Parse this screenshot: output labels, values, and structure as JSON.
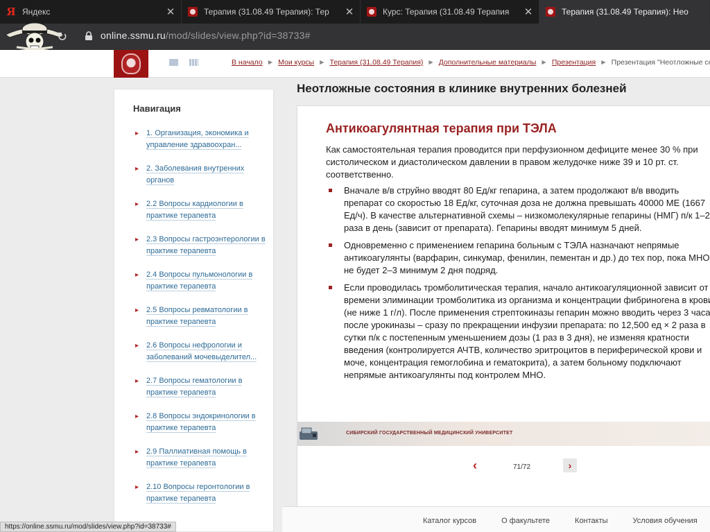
{
  "browser": {
    "tabs": [
      {
        "title": "Яндекс",
        "icon": "yandex-icon",
        "close": "✕"
      },
      {
        "title": "Терапия (31.08.49 Терапия): Тер",
        "icon": "university-crest-icon",
        "close": "✕"
      },
      {
        "title": "Курс: Терапия (31.08.49 Терапия",
        "icon": "university-crest-icon",
        "close": "✕"
      },
      {
        "title": "Терапия (31.08.49 Терапия): Нео",
        "icon": "university-crest-icon",
        "close": ""
      }
    ],
    "url_host": "online.ssmu.ru",
    "url_path": "/mod/slides/view.php?id=38733#"
  },
  "site": {
    "breadcrumb": [
      {
        "label": "В начало",
        "link": true
      },
      {
        "label": "Мои курсы",
        "link": true
      },
      {
        "label": "Терапия (31.08.49 Терапия)",
        "link": true
      },
      {
        "label": "Дополнительные материалы",
        "link": true
      },
      {
        "label": "Презентация",
        "link": true
      },
      {
        "label": "Презентация \"Неотложные состоя-",
        "link": false
      }
    ],
    "breadcrumb_sep": "►"
  },
  "sidebar": {
    "title": "Навигация",
    "items": [
      "1. Организация, экономика и управление здравоохран...",
      "2. Заболевания внутренних органов",
      "2.2 Вопросы кардиологии в практике терапевта",
      "2.3 Вопросы гастроэнтерологии в практике терапевта",
      "2.4 Вопросы пульмонологии в практике терапевта",
      "2.5 Вопросы ревматологии в практике терапевта",
      "2.6 Вопросы нефрологии и заболеваний мочевыделител...",
      "2.7 Вопросы гематологии в практике терапевта",
      "2.8 Вопросы эндокринологии в практике терапевта",
      "2.9 Паллиативная помощь в практике терапевта",
      "2.10 Вопросы геронтологии в практике терапевта"
    ]
  },
  "content": {
    "title": "Неотложные состояния в клинике внутренних болезней",
    "slide": {
      "title": "Антикоагулянтная терапия при ТЭЛА",
      "intro": "Как самостоятельная терапия проводится при перфузионном дефиците менее 30 % при систолическом и диастолическом давлении в правом желудочке ниже 39 и 10 рт. ст. соответственно.",
      "bullets": [
        "Вначале в/в струйно вводят 80 Ед/кг гепарина, а затем продолжают в/в вводить препарат со скоростью 18 Ед/кг, суточная доза не должна превышать 40000 МЕ (1667 Ед/ч). В качестве альтернативной схемы – низкомолекулярные гепарины (НМГ) п/к 1–2 раза в день (зависит от препарата). Гепарины вводят минимум 5 дней.",
        "Одновременно с применением гепарина больным с ТЭЛА назначают непрямые антикоагулянты (варфарин, синкумар, фенилин, пементан и др.) до тех пор, пока МНО не будет 2–3 минимум 2 дня подряд.",
        "Если проводилась тромболитическая терапия, начало антикоагуляционной зависит от времени элиминации тромболитика из организма и концентрации фибриногена в крови (не ниже 1 г/л). После применения стрептокиназы гепарин можно вводить через 3 часа, после урокиназы – сразу по прекращении инфузии препарата: по 12,500 ед × 2 раза в сутки п/к с постепенным уменьшением дозы (1 раз в 3 дня), не изменяя кратности введения (контролируется АЧТВ, количество эритроцитов в периферической крови и моче, концентрация гемоглобина и гематокрита), а затем больному подключают непрямые антикоагулянты под контролем МНО."
      ],
      "footer": "СИБИРСКИЙ ГОСУДАРСТВЕННЫЙ МЕДИЦИНСКИЙ УНИВЕРСИТЕТ"
    },
    "pager": {
      "prev": "‹",
      "count": "71/72",
      "next": "›"
    }
  },
  "footer": {
    "links": [
      "Каталог курсов",
      "О факультете",
      "Контакты",
      "Условия обучения"
    ]
  },
  "status": {
    "url": "https://online.ssmu.ru/mod/slides/view.php?id=38733#"
  },
  "colors": {
    "accent": "#9a2222",
    "link": "#2d6a96"
  }
}
